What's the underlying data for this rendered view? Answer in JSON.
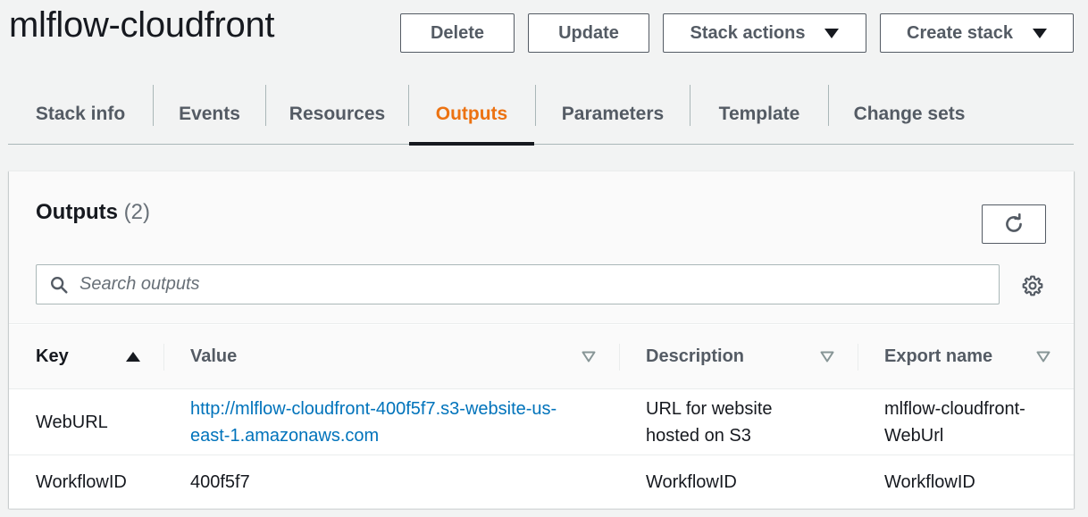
{
  "stack": {
    "title": "mlflow-cloudfront"
  },
  "actions": {
    "delete_label": "Delete",
    "update_label": "Update",
    "stack_actions_label": "Stack actions",
    "create_stack_label": "Create stack"
  },
  "tabs": [
    {
      "label": "Stack info",
      "active": false
    },
    {
      "label": "Events",
      "active": false
    },
    {
      "label": "Resources",
      "active": false
    },
    {
      "label": "Outputs",
      "active": true
    },
    {
      "label": "Parameters",
      "active": false
    },
    {
      "label": "Template",
      "active": false
    },
    {
      "label": "Change sets",
      "active": false
    }
  ],
  "outputs_panel": {
    "title": "Outputs",
    "count": "(2)",
    "search_placeholder": "Search outputs",
    "columns": [
      {
        "label": "Key",
        "sort": "ascending"
      },
      {
        "label": "Value",
        "sort": "none"
      },
      {
        "label": "Description",
        "sort": "none"
      },
      {
        "label": "Export name",
        "sort": "none"
      }
    ],
    "rows": [
      {
        "key": "WebURL",
        "value": "http://mlflow-cloudfront-400f5f7.s3-website-us-east-1.amazonaws.com",
        "value_is_link": true,
        "description": "URL for website hosted on S3",
        "export_name": "mlflow-cloudfront-WebUrl"
      },
      {
        "key": "WorkflowID",
        "value": "400f5f7",
        "value_is_link": false,
        "description": "WorkflowID",
        "export_name": "WorkflowID"
      }
    ]
  },
  "colors": {
    "accent_active_tab": "#ec7211",
    "link": "#0073bb",
    "text": "#16191f",
    "muted": "#545b64"
  },
  "icons": {
    "refresh": "refresh-icon",
    "search": "search-icon",
    "settings": "gear-icon",
    "dropdown": "caret-down-icon",
    "sort_asc": "sort-ascending-icon",
    "sort_none": "sort-descending-outline-icon"
  }
}
